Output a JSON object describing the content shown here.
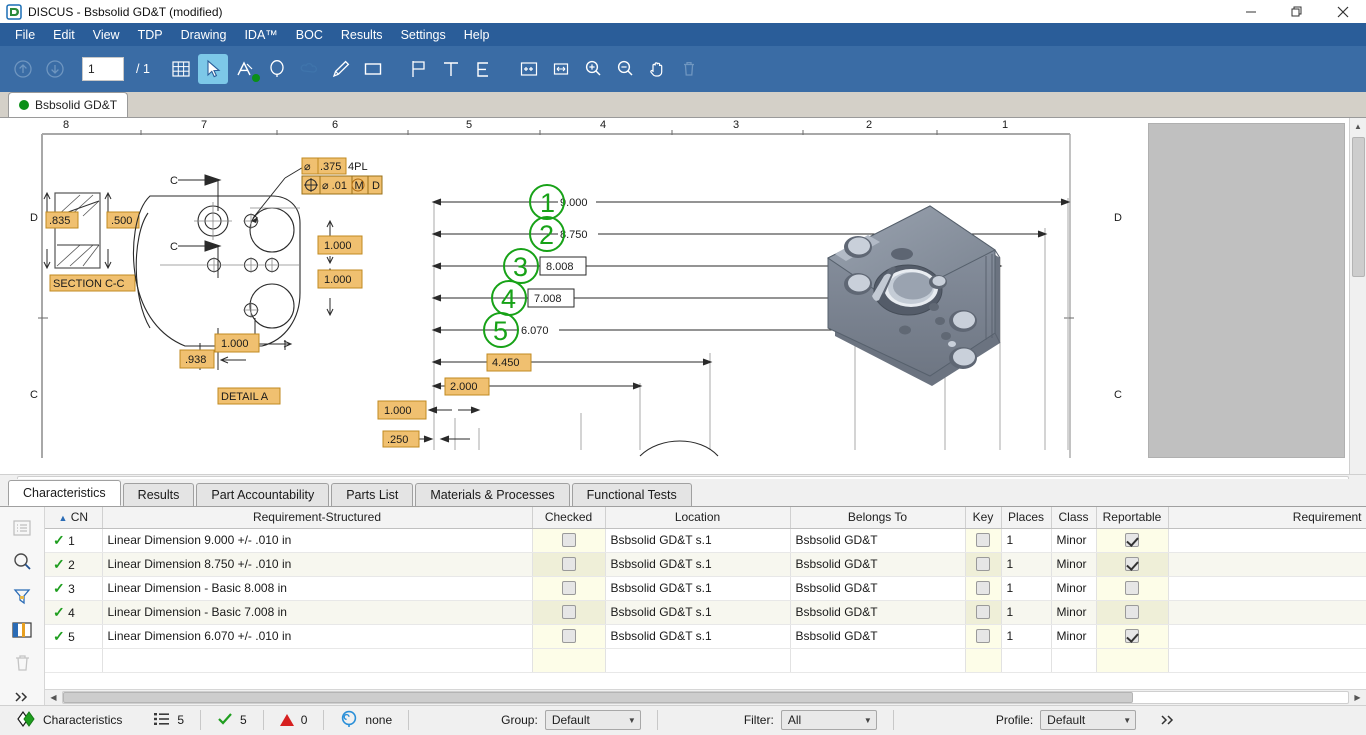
{
  "window": {
    "title": "DISCUS - Bsbsolid GD&T (modified)",
    "app_icon": "discus-logo-icon",
    "minimize": "–",
    "restore": "restore-icon",
    "close": "×"
  },
  "menubar": {
    "items": [
      {
        "label": "File"
      },
      {
        "label": "Edit"
      },
      {
        "label": "View"
      },
      {
        "label": "TDP"
      },
      {
        "label": "Drawing"
      },
      {
        "label": "IDA™"
      },
      {
        "label": "BOC"
      },
      {
        "label": "Results"
      },
      {
        "label": "Settings"
      },
      {
        "label": "Help"
      }
    ]
  },
  "toolbar": {
    "prev_page_icon": "arrow-up-circle-icon",
    "next_page_icon": "arrow-down-circle-icon",
    "page_value": "1",
    "page_total": "/ 1",
    "buttons": [
      {
        "name": "grid-icon",
        "label": "Grid"
      },
      {
        "name": "select-cursor-icon",
        "label": "Select",
        "selected": true
      },
      {
        "name": "annotate-a-icon",
        "label": "Annotate",
        "badge": true
      },
      {
        "name": "balloon-icon",
        "label": "Balloon"
      },
      {
        "name": "cloud-icon",
        "label": "Cloud"
      },
      {
        "name": "pen-icon",
        "label": "Pen"
      },
      {
        "name": "rectangle-icon",
        "label": "Rectangle"
      },
      {
        "name": "flag-icon",
        "label": "Flag"
      },
      {
        "name": "text-t-icon",
        "label": "Text"
      },
      {
        "name": "letter-e-icon",
        "label": "E"
      },
      {
        "name": "fit-page-icon",
        "label": "Fit Page"
      },
      {
        "name": "fit-width-icon",
        "label": "Fit Width"
      },
      {
        "name": "zoom-in-icon",
        "label": "Zoom In"
      },
      {
        "name": "zoom-out-icon",
        "label": "Zoom Out"
      },
      {
        "name": "pan-hand-icon",
        "label": "Pan"
      },
      {
        "name": "trash-icon",
        "label": "Delete"
      }
    ]
  },
  "document_tab": {
    "label": "Bsbsolid GD&T",
    "status_color": "#0a8f18"
  },
  "drawing": {
    "ruler_columns": [
      "8",
      "7",
      "6",
      "5",
      "4",
      "3",
      "2",
      "1"
    ],
    "row_letters_left": [
      "D",
      "C"
    ],
    "row_letters_right": [
      "D",
      "C"
    ],
    "section_view": {
      "title": "SECTION C-C",
      "dim_left": ".835",
      "dim_right": ".500"
    },
    "detail_view": {
      "title": "DETAIL A",
      "hole_note": ".375",
      "hole_note_prefix": "⌀",
      "hole_qty": "4PL",
      "fcf": {
        "symbol": "position-icon",
        "diameter": "⌀",
        "tolerance": ".01",
        "modifier": "M",
        "datum": "D"
      },
      "section_marks": [
        "C",
        "C"
      ],
      "dims": [
        "1.000",
        "1.000",
        "1.000",
        ".938"
      ]
    },
    "dimension_stack": [
      {
        "balloon": "1",
        "value": "9.000",
        "basic": false
      },
      {
        "balloon": "2",
        "value": "8.750",
        "basic": false
      },
      {
        "balloon": "3",
        "value": "8.008",
        "basic": true
      },
      {
        "balloon": "4",
        "value": "7.008",
        "basic": true
      },
      {
        "balloon": "5",
        "value": "6.070",
        "basic": false
      }
    ],
    "other_dims": [
      "4.450",
      "2.000",
      "1.000",
      ".250"
    ],
    "balloon_color": "#17a217",
    "highlight_color": "#f0c070",
    "model_caption": ""
  },
  "panel_tabs": [
    {
      "label": "Characteristics",
      "active": true
    },
    {
      "label": "Results",
      "active": false
    },
    {
      "label": "Part Accountability",
      "active": false
    },
    {
      "label": "Parts List",
      "active": false
    },
    {
      "label": "Materials & Processes",
      "active": false
    },
    {
      "label": "Functional Tests",
      "active": false
    }
  ],
  "rail_buttons": [
    {
      "name": "list-icon",
      "label": "List",
      "disabled": true
    },
    {
      "name": "search-icon",
      "label": "Search",
      "disabled": false
    },
    {
      "name": "filter-funnel-icon",
      "label": "Filter",
      "disabled": false
    },
    {
      "name": "columns-icon",
      "label": "Columns",
      "disabled": false
    },
    {
      "name": "trash-icon",
      "label": "Delete",
      "disabled": true
    },
    {
      "name": "chevron-double-right-icon",
      "label": "More",
      "disabled": false
    }
  ],
  "table": {
    "sort_column": "CN",
    "sort_direction": "asc",
    "columns": [
      {
        "key": "cn",
        "label": "CN"
      },
      {
        "key": "requirement_structured",
        "label": "Requirement-Structured"
      },
      {
        "key": "checked",
        "label": "Checked"
      },
      {
        "key": "location",
        "label": "Location"
      },
      {
        "key": "belongs_to",
        "label": "Belongs To"
      },
      {
        "key": "key",
        "label": "Key"
      },
      {
        "key": "places",
        "label": "Places"
      },
      {
        "key": "class",
        "label": "Class"
      },
      {
        "key": "reportable",
        "label": "Reportable"
      },
      {
        "key": "requirement",
        "label": "Requirement"
      }
    ],
    "rows": [
      {
        "cn": "1",
        "requirement_structured": "Linear Dimension 9.000 +/- .010 in",
        "checked": false,
        "location": "Bsbsolid GD&T s.1",
        "belongs_to": "Bsbsolid GD&T",
        "key": false,
        "places": "1",
        "class": "Minor",
        "reportable": true,
        "requirement": ""
      },
      {
        "cn": "2",
        "requirement_structured": "Linear Dimension 8.750 +/- .010 in",
        "checked": false,
        "location": "Bsbsolid GD&T s.1",
        "belongs_to": "Bsbsolid GD&T",
        "key": false,
        "places": "1",
        "class": "Minor",
        "reportable": true,
        "requirement": ""
      },
      {
        "cn": "3",
        "requirement_structured": "Linear Dimension - Basic 8.008 in",
        "checked": false,
        "location": "Bsbsolid GD&T s.1",
        "belongs_to": "Bsbsolid GD&T",
        "key": false,
        "places": "1",
        "class": "Minor",
        "reportable": false,
        "requirement": ""
      },
      {
        "cn": "4",
        "requirement_structured": "Linear Dimension - Basic 7.008 in",
        "checked": false,
        "location": "Bsbsolid GD&T s.1",
        "belongs_to": "Bsbsolid GD&T",
        "key": false,
        "places": "1",
        "class": "Minor",
        "reportable": false,
        "requirement": ""
      },
      {
        "cn": "5",
        "requirement_structured": "Linear Dimension 6.070 +/- .010 in",
        "checked": false,
        "location": "Bsbsolid GD&T s.1",
        "belongs_to": "Bsbsolid GD&T",
        "key": false,
        "places": "1",
        "class": "Minor",
        "reportable": true,
        "requirement": ""
      }
    ]
  },
  "statusbar": {
    "mode_icon": "characteristics-icon",
    "mode_label": "Characteristics",
    "count_icon": "list-icon",
    "count_value": "5",
    "checked_icon": "check-icon",
    "checked_value": "5",
    "error_icon": "warning-triangle-icon",
    "error_value": "0",
    "balloon_icon": "balloon-icon",
    "balloon_value": "none",
    "group_label": "Group:",
    "group_value": "Default",
    "filter_label": "Filter:",
    "filter_value": "All",
    "profile_label": "Profile:",
    "profile_value": "Default",
    "overflow_icon": "chevron-double-right-icon"
  }
}
